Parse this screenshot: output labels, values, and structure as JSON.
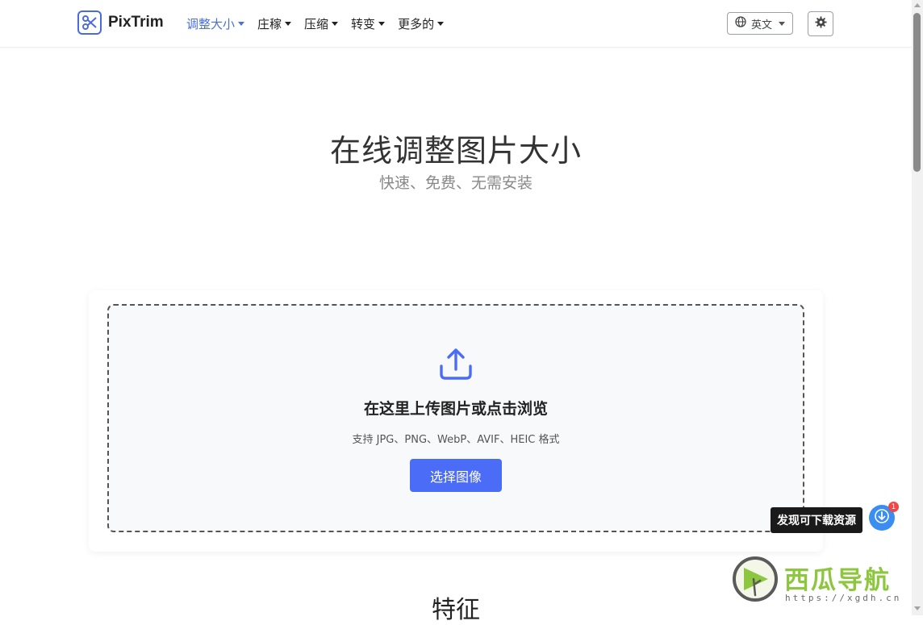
{
  "brand": {
    "name": "PixTrim",
    "logo_icon": "scissors-icon"
  },
  "nav": {
    "items": [
      {
        "label": "调整大小",
        "active": true
      },
      {
        "label": "庄稼",
        "active": false
      },
      {
        "label": "压缩",
        "active": false
      },
      {
        "label": "转变",
        "active": false
      },
      {
        "label": "更多的",
        "active": false
      }
    ]
  },
  "language": {
    "label": "英文",
    "icon": "globe-icon"
  },
  "settings": {
    "icon": "gear-icon"
  },
  "hero": {
    "title": "在线调整图片大小",
    "subtitle": "快速、免费、无需安装"
  },
  "upload": {
    "icon": "upload-icon",
    "title": "在这里上传图片或点击浏览",
    "formats": "支持 JPG、PNG、WebP、AVIF、HEIC 格式",
    "button_label": "选择图像"
  },
  "features": {
    "heading": "特征"
  },
  "floating": {
    "tooltip": "发现可下载资源",
    "badge_count": "1"
  },
  "watermark": {
    "name": "西瓜导航",
    "url": "https://xgdh.cn"
  },
  "colors": {
    "accent": "#4a6cf7",
    "nav_active": "#4a6fe0",
    "badge_red": "#f04646",
    "watermark_green": "#8dc63f"
  }
}
